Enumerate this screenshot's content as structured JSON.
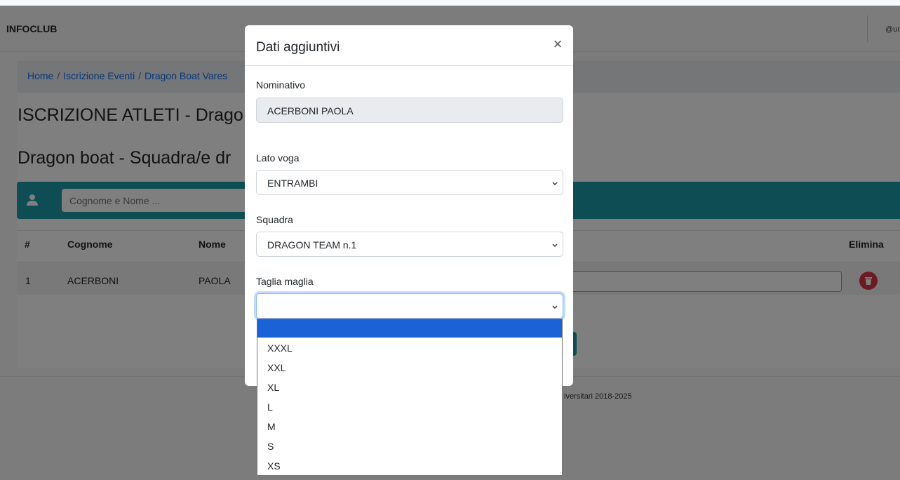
{
  "navbar": {
    "brand": "INFOCLUB",
    "user": "@ur"
  },
  "breadcrumb": {
    "home": "Home",
    "events": "Iscrizione Eventi",
    "current": "Dragon Boat Vares"
  },
  "page": {
    "title": "ISCRIZIONE ATLETI - Drago",
    "subtitle": "Dragon boat - Squadra/e dr"
  },
  "search": {
    "placeholder": "Cognome e Nome ..."
  },
  "table": {
    "headers": {
      "num": "#",
      "cognome": "Cognome",
      "nome": "Nome",
      "elimina": "Elimina"
    },
    "rows": [
      {
        "num": "1",
        "cognome": "ACERBONI",
        "nome": "PAOLA"
      }
    ]
  },
  "footer": {
    "text": "iversitari 2018-2025"
  },
  "modal": {
    "title": "Dati aggiuntivi",
    "close": "×",
    "nominativo": {
      "label": "Nominativo",
      "value": "ACERBONI PAOLA"
    },
    "lato_voga": {
      "label": "Lato voga",
      "value": "ENTRAMBI"
    },
    "squadra": {
      "label": "Squadra",
      "value": "DRAGON TEAM n.1"
    },
    "taglia": {
      "label": "Taglia maglia",
      "value": "",
      "options": [
        "",
        "XXXL",
        "XXL",
        "XL",
        "L",
        "M",
        "S",
        "XS"
      ]
    }
  },
  "colors": {
    "teal": "#1c9aa8",
    "link": "#0d6efd",
    "danger": "#dc3545",
    "selected_option": "#1a62d6"
  }
}
